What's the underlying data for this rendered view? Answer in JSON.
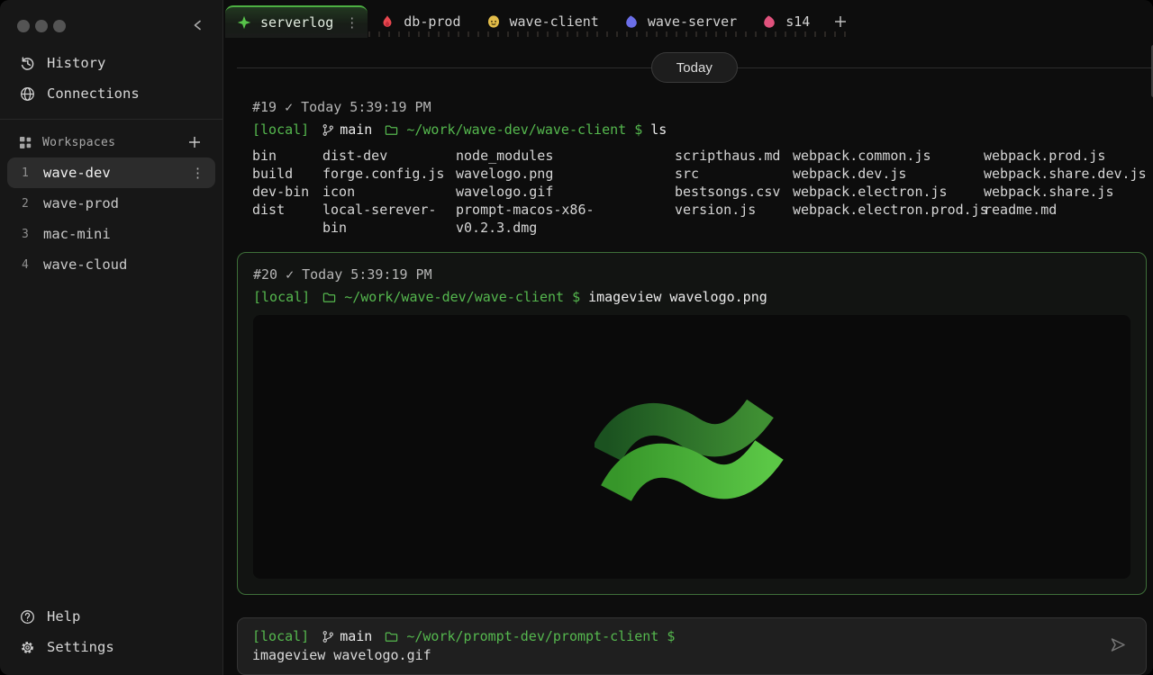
{
  "colors": {
    "accent-green": "#55b84e",
    "border-green": "#3e6f39",
    "bg-main": "#0d0d0d",
    "bg-sidebar": "#171717",
    "tab-red": "#e8474f",
    "tab-yellow": "#e3bd4a",
    "tab-blue": "#6b6ee8",
    "tab-pink": "#e0527d",
    "logo-dark-start": "#1b5220",
    "logo-dark-end": "#3f8f33",
    "logo-light-start": "#37962a",
    "logo-light-end": "#5bc746"
  },
  "sidebar": {
    "nav": [
      {
        "label": "History",
        "icon": "history-icon"
      },
      {
        "label": "Connections",
        "icon": "globe-icon"
      }
    ],
    "workspaces": {
      "header": "Workspaces",
      "items": [
        {
          "index": "1",
          "label": "wave-dev",
          "active": true
        },
        {
          "index": "2",
          "label": "wave-prod",
          "active": false
        },
        {
          "index": "3",
          "label": "mac-mini",
          "active": false
        },
        {
          "index": "4",
          "label": "wave-cloud",
          "active": false
        }
      ]
    },
    "footer": [
      {
        "label": "Help",
        "icon": "help-icon"
      },
      {
        "label": "Settings",
        "icon": "gear-icon"
      }
    ]
  },
  "tabs": [
    {
      "label": "serverlog",
      "icon": "sparkle-icon",
      "active": true,
      "menu": "⋮"
    },
    {
      "label": "db-prod",
      "icon": "flame-icon",
      "active": false
    },
    {
      "label": "wave-client",
      "icon": "happy-blob-icon",
      "active": false
    },
    {
      "label": "wave-server",
      "icon": "blob-icon",
      "active": false
    },
    {
      "label": "s14",
      "icon": "blob-icon",
      "active": false
    }
  ],
  "terminal": {
    "date_divider": "Today",
    "blocks": [
      {
        "id": "#19",
        "check": "✓",
        "timestamp": "Today 5:39:19 PM",
        "prompt": {
          "host": "[local]",
          "branch": "main",
          "cwd": "~/work/wave-dev/wave-client",
          "symbol": "$"
        },
        "command": "ls",
        "output_columns": [
          [
            "bin",
            "build",
            "dev-bin",
            "dist"
          ],
          [
            "dist-dev",
            "forge.config.js",
            "icon",
            "local-serever-bin"
          ],
          [
            "node_modules",
            "wavelogo.png",
            "wavelogo.gif",
            "prompt-macos-x86-v0.2.3.dmg"
          ],
          [
            "scripthaus.md",
            "src",
            "bestsongs.csv",
            "version.js"
          ],
          [
            "webpack.common.js",
            "webpack.dev.js",
            "webpack.electron.js",
            "webpack.electron.prod.js"
          ],
          [
            "webpack.prod.js",
            "webpack.share.dev.js",
            "webpack.share.js",
            "readme.md"
          ]
        ]
      },
      {
        "id": "#20",
        "check": "✓",
        "timestamp": "Today 5:39:19 PM",
        "prompt": {
          "host": "[local]",
          "cwd": "~/work/wave-dev/wave-client",
          "symbol": "$"
        },
        "command": "imageview wavelogo.png",
        "image": "wave-logo"
      }
    ],
    "input": {
      "host": "[local]",
      "branch": "main",
      "cwd": "~/work/prompt-dev/prompt-client",
      "symbol": "$",
      "value": "imageview wavelogo.gif"
    }
  }
}
